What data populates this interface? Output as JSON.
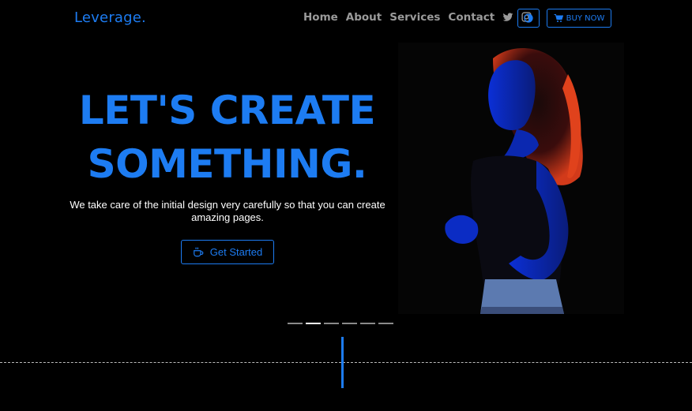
{
  "brand": {
    "logo": "Leverage."
  },
  "nav": {
    "items": [
      "Home",
      "About",
      "Services",
      "Contact"
    ],
    "icons": [
      "twitter-icon",
      "instagram-icon"
    ],
    "theme_toggle_icon": "contrast-icon",
    "buy_label": "BUY NOW",
    "buy_icon": "cart-icon"
  },
  "hero": {
    "title_line1": "LET'S CREATE",
    "title_line2": "SOMETHING.",
    "description": "We take care of the initial design very carefully so that you can create amazing pages.",
    "cta_label": "Get Started",
    "cta_icon": "coffee-icon"
  },
  "slider": {
    "count": 6,
    "active_index": 1
  },
  "colors": {
    "accent": "#1d7cf2",
    "background": "#000000",
    "nav_text": "#9a9a9a"
  }
}
